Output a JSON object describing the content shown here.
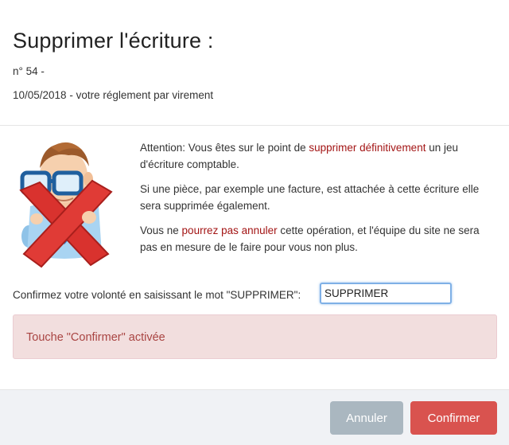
{
  "dialog": {
    "title": "Supprimer l'écriture :",
    "entry_number": "n° 54 -",
    "entry_description": "10/05/2018 - votre réglement par virement"
  },
  "warning": {
    "p1_before": "Attention: Vous êtes sur le point de ",
    "p1_highlight": "supprimer définitivement",
    "p1_after": " un jeu d'écriture comptable.",
    "p2": "Si une pièce, par exemple une facture, est attachée à cette écriture elle sera supprimée également.",
    "p3_before": "Vous ne ",
    "p3_highlight": "pourrez pas annuler",
    "p3_after": " cette opération, et l'équipe du site ne sera pas en mesure de le faire pour vous non plus."
  },
  "confirmation": {
    "label": "Confirmez votre volonté en saisissant le mot \"SUPPRIMER\":",
    "input_value": "SUPPRIMER"
  },
  "alert": {
    "text": "Touche \"Confirmer\" activée"
  },
  "footer": {
    "cancel_label": "Annuler",
    "confirm_label": "Confirmer"
  },
  "colors": {
    "highlight": "#a31515",
    "alert_bg": "#f2dede",
    "alert_text": "#a94442",
    "confirm_button": "#d9534f",
    "cancel_button": "#aab7c0"
  },
  "icons": {
    "illustration": "man-with-red-x-icon"
  }
}
